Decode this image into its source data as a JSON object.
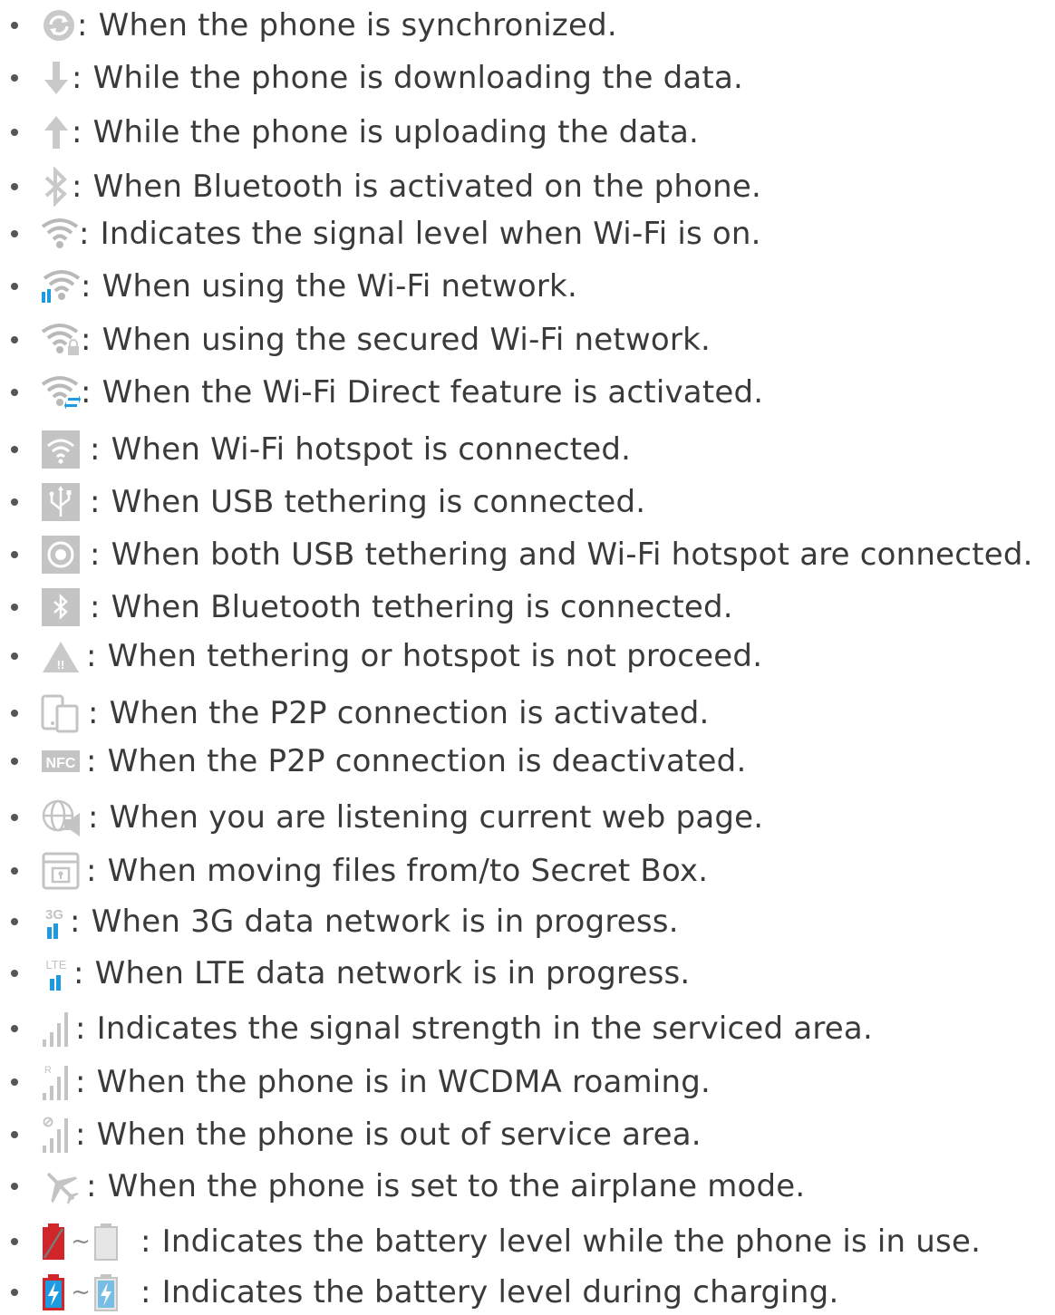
{
  "items": [
    {
      "icon": "sync-icon",
      "colon": ":",
      "text": "When the phone is synchronized."
    },
    {
      "icon": "download-arrow-icon",
      "colon": ":",
      "text": "While the phone is downloading the data."
    },
    {
      "icon": "upload-arrow-icon",
      "colon": ":",
      "text": "While the phone is uploading the data."
    },
    {
      "icon": "bluetooth-icon",
      "colon": ":",
      "text": "When Bluetooth is activated on the phone."
    },
    {
      "icon": "wifi-signal-icon",
      "colon": ":",
      "text": "Indicates the signal level when Wi-Fi is on."
    },
    {
      "icon": "wifi-in-use-icon",
      "colon": ":",
      "text": "When using the Wi-Fi network."
    },
    {
      "icon": "wifi-secured-icon",
      "colon": ":",
      "text": "When using the secured Wi-Fi network."
    },
    {
      "icon": "wifi-direct-icon",
      "colon": ":",
      "text": "When the Wi-Fi Direct feature is activated."
    },
    {
      "icon": "wifi-hotspot-icon",
      "colon": ":",
      "text": "When Wi-Fi hotspot is connected."
    },
    {
      "icon": "usb-tethering-icon",
      "colon": ":",
      "text": "When USB tethering is connected."
    },
    {
      "icon": "usb-and-hotspot-icon",
      "colon": ":",
      "text": "When both USB tethering and Wi-Fi hotspot are connected."
    },
    {
      "icon": "bluetooth-tethering-icon",
      "colon": ":",
      "text": "When Bluetooth tethering is connected."
    },
    {
      "icon": "tethering-error-icon",
      "colon": ":",
      "text": "When tethering or hotspot is not proceed."
    },
    {
      "icon": "p2p-active-icon",
      "colon": ":",
      "text": "When the P2P connection is activated."
    },
    {
      "icon": "nfc-icon",
      "colon": ":",
      "text": "When the P2P connection is deactivated."
    },
    {
      "icon": "web-listening-icon",
      "colon": ":",
      "text": "When you are listening current web page."
    },
    {
      "icon": "secret-box-icon",
      "colon": ":",
      "text": "When moving files from/to Secret Box."
    },
    {
      "icon": "3g-data-icon",
      "colon": ":",
      "text": "When 3G data network is in progress."
    },
    {
      "icon": "lte-data-icon",
      "colon": ":",
      "text": "When LTE data network is in progress."
    },
    {
      "icon": "signal-strength-icon",
      "colon": ":",
      "text": "Indicates the signal strength in the serviced area."
    },
    {
      "icon": "roaming-signal-icon",
      "colon": ":",
      "text": "When the phone is in WCDMA roaming."
    },
    {
      "icon": "no-service-icon",
      "colon": ":",
      "text": "When the phone is out of service area."
    },
    {
      "icon": "airplane-icon",
      "colon": ":",
      "text": "When the phone is set to the airplane mode."
    },
    {
      "icon": "battery-level-icon",
      "colon": ":",
      "text": "Indicates the battery level while the phone is in use."
    },
    {
      "icon": "battery-charging-icon",
      "colon": ":",
      "text": "Indicates the battery level during charging."
    }
  ],
  "icon_labels": {
    "nfc": "NFC",
    "threeg": "3G",
    "lte": "LTE",
    "roaming": "R",
    "tilde": "~"
  },
  "colors": {
    "text": "#3a3a3a",
    "icon_gray": "#bdbdbd",
    "icon_blue": "#1e9be0",
    "battery_red": "#d0262a"
  }
}
